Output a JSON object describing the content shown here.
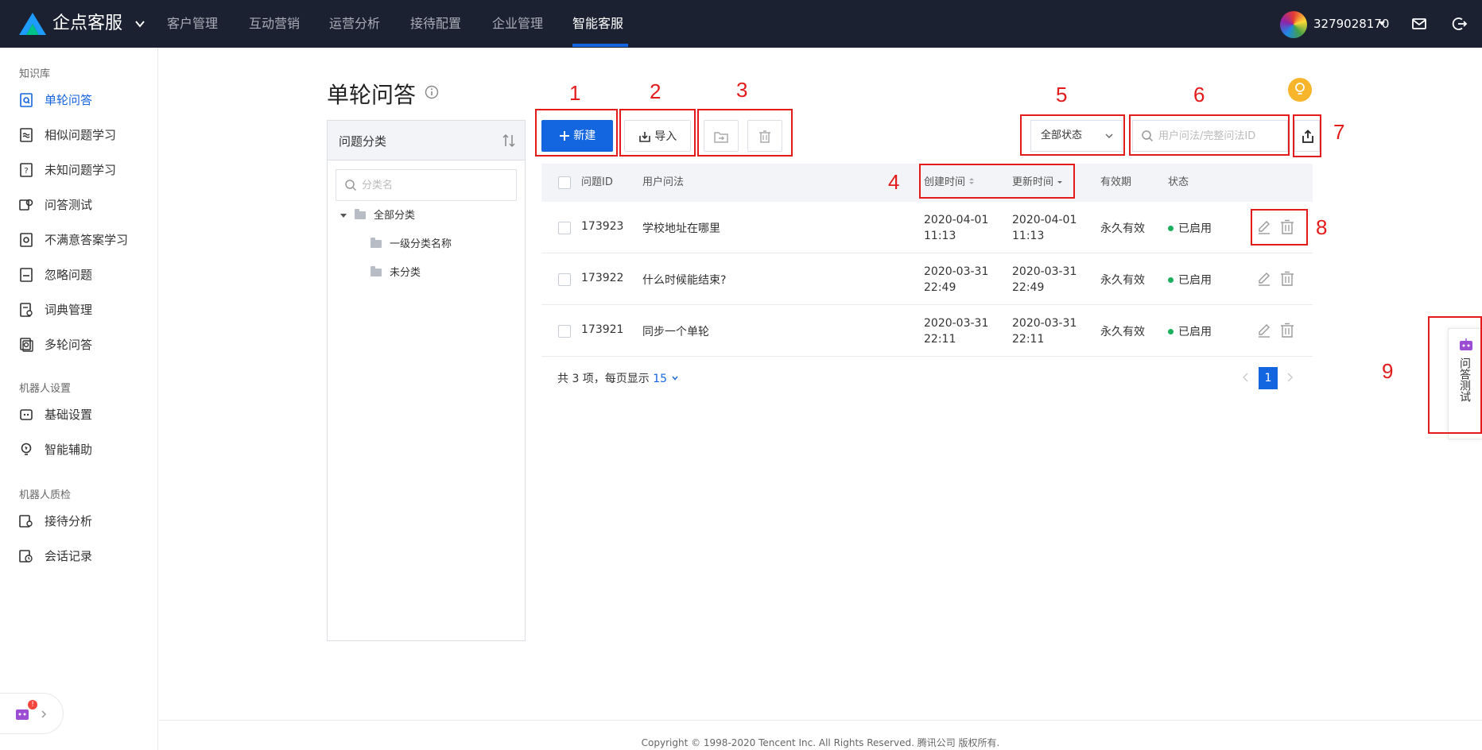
{
  "topbar": {
    "brand": "企点客服",
    "nav": [
      "客户管理",
      "互动营销",
      "运营分析",
      "接待配置",
      "企业管理",
      "智能客服"
    ],
    "active_nav": "智能客服",
    "user": "3279028170"
  },
  "sidebar": {
    "group1": "知识库",
    "kb_items": [
      {
        "label": "单轮问答",
        "icon": "doc-search-icon"
      },
      {
        "label": "相似问题学习",
        "icon": "approx-icon"
      },
      {
        "label": "未知问题学习",
        "icon": "question-icon"
      },
      {
        "label": "问答测试",
        "icon": "chat-test-icon"
      },
      {
        "label": "不满意答案学习",
        "icon": "dissatisfied-icon"
      },
      {
        "label": "忽略问题",
        "icon": "ignore-icon"
      },
      {
        "label": "词典管理",
        "icon": "dictionary-icon"
      },
      {
        "label": "多轮问答",
        "icon": "multi-qa-icon"
      }
    ],
    "group2": "机器人设置",
    "robot_items": [
      {
        "label": "基础设置",
        "icon": "robot-settings-icon"
      },
      {
        "label": "智能辅助",
        "icon": "bulb-assist-icon"
      }
    ],
    "group3": "机器人质检",
    "qa_items": [
      {
        "label": "接待分析",
        "icon": "reception-analysis-icon"
      },
      {
        "label": "会话记录",
        "icon": "session-record-icon"
      }
    ],
    "robot_badge": "!"
  },
  "page": {
    "title": "单轮问答"
  },
  "category": {
    "header": "问题分类",
    "search_placeholder": "分类名",
    "tree": [
      "全部分类",
      "一级分类名称",
      "未分类"
    ]
  },
  "toolbar": {
    "new_label": "新建",
    "import_label": "导入",
    "status_select": "全部状态",
    "search_placeholder": "用户问法/完整问法ID"
  },
  "table": {
    "columns": [
      "问题ID",
      "用户问法",
      "创建时间",
      "更新时间",
      "有效期",
      "状态"
    ],
    "rows": [
      {
        "id": "173923",
        "question": "学校地址在哪里",
        "created_date": "2020-04-01",
        "created_time": "11:13",
        "updated_date": "2020-04-01",
        "updated_time": "11:13",
        "validity": "永久有效",
        "status": "已启用"
      },
      {
        "id": "173922",
        "question": "什么时候能结束?",
        "created_date": "2020-03-31",
        "created_time": "22:49",
        "updated_date": "2020-03-31",
        "updated_time": "22:49",
        "validity": "永久有效",
        "status": "已启用"
      },
      {
        "id": "173921",
        "question": "同步一个单轮",
        "created_date": "2020-03-31",
        "created_time": "22:11",
        "updated_date": "2020-03-31",
        "updated_time": "22:11",
        "validity": "永久有效",
        "status": "已启用"
      }
    ]
  },
  "pager": {
    "summary": "共 3 项，每页显示",
    "page_size": "15",
    "current_page": "1"
  },
  "float_test": {
    "label": "问答测试"
  },
  "annotations": [
    "1",
    "2",
    "3",
    "4",
    "5",
    "6",
    "7",
    "8",
    "9"
  ],
  "footer": "Copyright © 1998-2020 Tencent Inc. All Rights Reserved. 腾讯公司 版权所有.",
  "colors": {
    "topbar": "#1b2130",
    "accent": "#1465e0",
    "annotation_red": "#e31b1b",
    "status_green": "#1bb05c"
  }
}
